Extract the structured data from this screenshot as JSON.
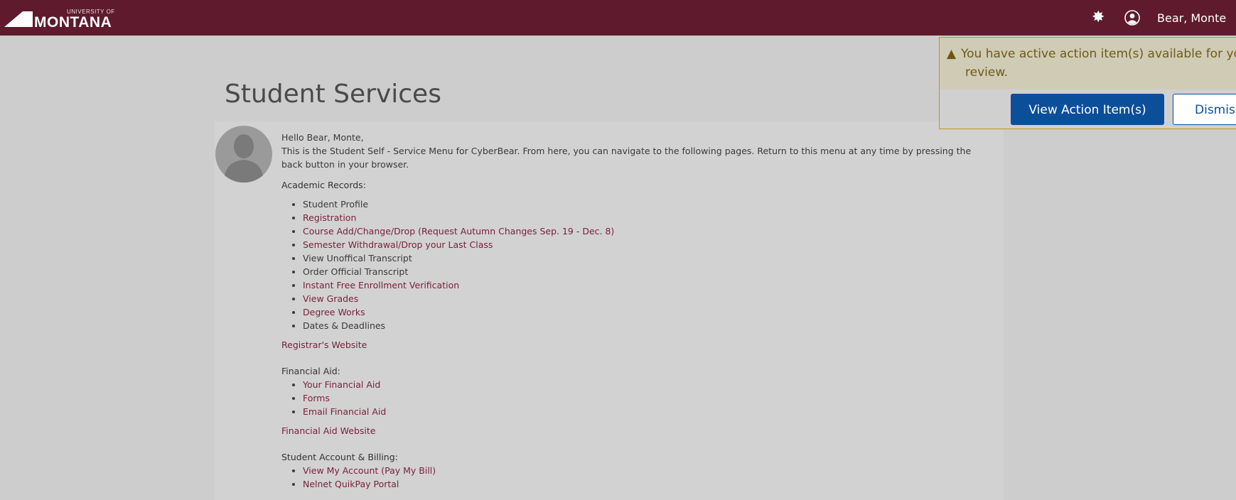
{
  "header": {
    "logo_top": "UNIVERSITY OF",
    "logo_main": "MONTANA",
    "user_name": "Bear, Monte",
    "settings_icon": "gear-icon",
    "user_icon": "user-circle-icon",
    "brand_color": "#5f1a2e"
  },
  "page": {
    "title": "Student Services",
    "greeting": "Hello Bear, Monte,",
    "intro": "This is the Student Self - Service Menu for CyberBear. From here, you can navigate to the following pages. Return to this menu at any time by pressing the back button in your browser."
  },
  "sections": {
    "academic": {
      "title": "Academic Records:",
      "items": [
        {
          "label": "Student Profile",
          "link": false
        },
        {
          "label": "Registration",
          "link": true
        },
        {
          "label": "Course Add/Change/Drop (Request Autumn Changes Sep. 19 - Dec. 8)",
          "link": true
        },
        {
          "label": "Semester Withdrawal/Drop your Last Class",
          "link": true
        },
        {
          "label": "View Unoffical Transcript",
          "link": false
        },
        {
          "label": "Order Official Transcript",
          "link": false
        },
        {
          "label": "Instant Free Enrollment Verification",
          "link": true
        },
        {
          "label": "View Grades",
          "link": true
        },
        {
          "label": "Degree Works",
          "link": true
        },
        {
          "label": "Dates & Deadlines",
          "link": false
        }
      ],
      "site_link": "Registrar's Website"
    },
    "financial": {
      "title": "Financial Aid:",
      "items": [
        {
          "label": "Your Financial Aid",
          "link": true
        },
        {
          "label": "Forms",
          "link": true
        },
        {
          "label": "Email Financial Aid",
          "link": true
        }
      ],
      "site_link": "Financial Aid Website"
    },
    "billing": {
      "title": "Student Account & Billing:",
      "items": [
        {
          "label": "View My Account (Pay My Bill)",
          "link": true
        },
        {
          "label": "Nelnet QuikPay Portal",
          "link": true
        }
      ]
    }
  },
  "alert": {
    "icon": "warning-icon",
    "line1": "You have active action item(s) available for yo",
    "line2": "review.",
    "view_label": "View Action Item(s)",
    "dismiss_label": "Dismiss"
  }
}
